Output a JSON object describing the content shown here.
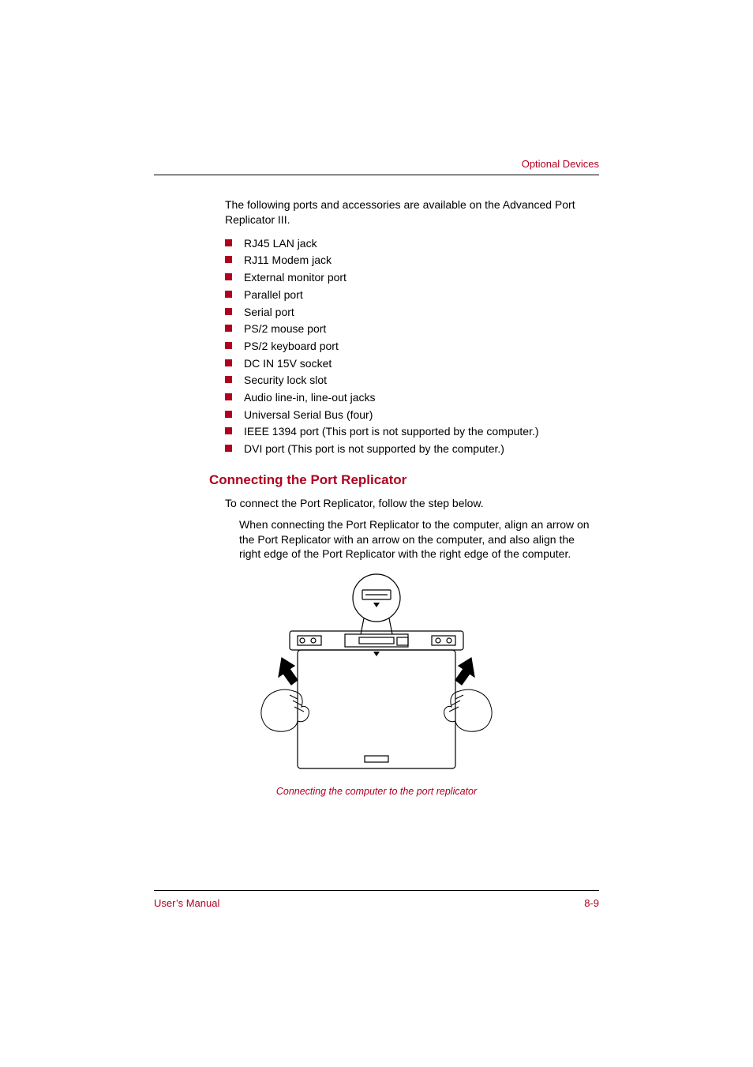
{
  "header": {
    "section_label": "Optional Devices"
  },
  "intro": "The following ports and accessories are available on the Advanced Port Replicator III.",
  "ports": [
    "RJ45 LAN jack",
    "RJ11 Modem jack",
    "External monitor port",
    "Parallel port",
    "Serial port",
    "PS/2 mouse port",
    "PS/2 keyboard port",
    "DC IN 15V socket",
    "Security lock slot",
    "Audio line-in, line-out jacks",
    "Universal Serial Bus (four)",
    "IEEE 1394 port (This port is not supported by the computer.)",
    "DVI port (This port is not supported by the computer.)"
  ],
  "section_heading": "Connecting the Port Replicator",
  "connect_intro": "To connect the Port Replicator, follow the step below.",
  "connect_step": "When connecting the Port Replicator to the computer, align an arrow on the Port Replicator with an arrow on the computer, and also align the right edge of the Port Replicator with the right edge of the computer.",
  "figure_caption": "Connecting the computer to the port replicator",
  "footer": {
    "left": "User’s Manual",
    "right": "8-9"
  }
}
